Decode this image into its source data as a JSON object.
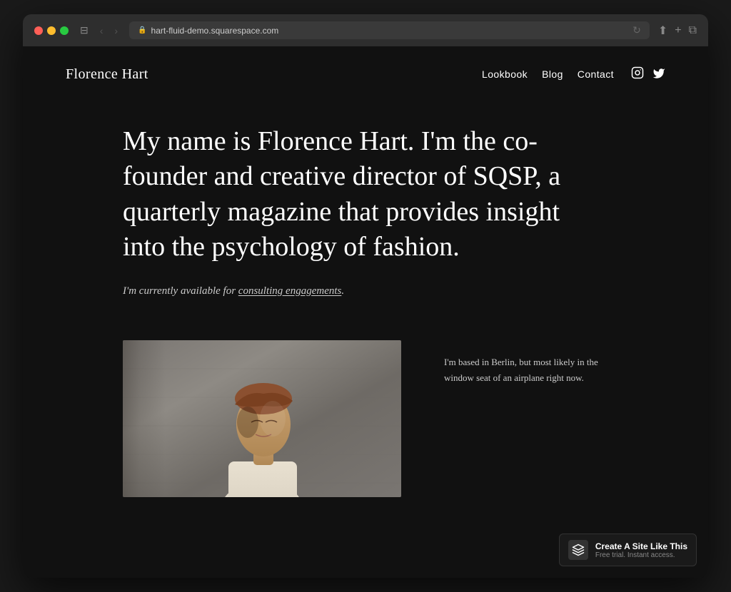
{
  "browser": {
    "url": "hart-fluid-demo.squarespace.com",
    "refresh_icon": "↻",
    "back_icon": "‹",
    "forward_icon": "›",
    "window_controls_icon": "⊟",
    "share_icon": "⬆",
    "add_tab_icon": "+",
    "duplicate_icon": "⧉"
  },
  "nav": {
    "logo": "Florence Hart",
    "links": [
      {
        "label": "Lookbook",
        "href": "#"
      },
      {
        "label": "Blog",
        "href": "#"
      },
      {
        "label": "Contact",
        "href": "#"
      }
    ],
    "social": {
      "instagram_label": "Instagram",
      "twitter_label": "Twitter"
    }
  },
  "hero": {
    "title": "My name is Florence Hart. I'm the co-founder and creative director of SQSP, a quarterly magazine that provides insight into the psychology of fashion.",
    "subtitle_prefix": "I'm currently available for ",
    "subtitle_link": "consulting engagements",
    "subtitle_suffix": "."
  },
  "sidebar": {
    "text": "I'm based in Berlin, but most likely in the window seat of an airplane right now."
  },
  "badge": {
    "title": "Create A Site Like This",
    "subtitle": "Free trial. Instant access.",
    "icon": "◈"
  }
}
